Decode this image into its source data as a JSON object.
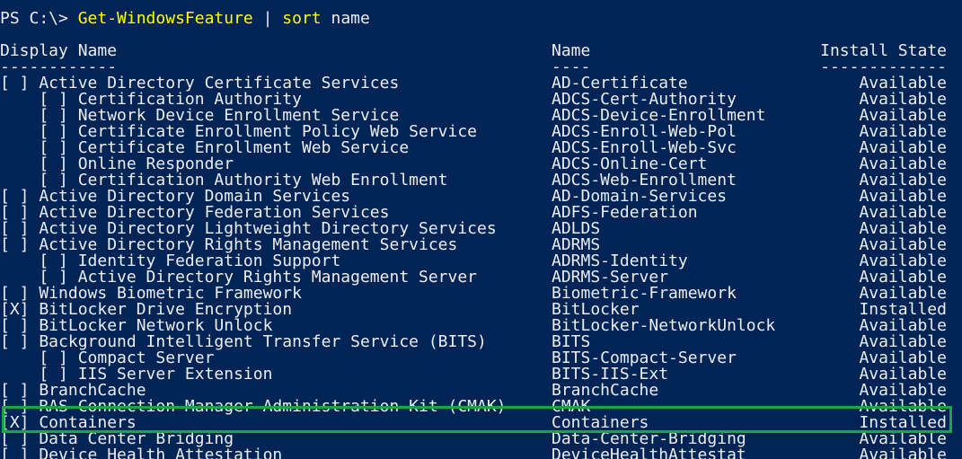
{
  "prompt": {
    "path": "PS C:\\> ",
    "cmdlet": "Get-WindowsFeature",
    "pipe": " | ",
    "sort_cmd": "sort",
    "arg": " name"
  },
  "headers": {
    "display_name": "Display Name",
    "name": "Name",
    "install_state": "Install State",
    "display_name_rule": "------------",
    "name_rule": "----",
    "install_state_rule": "-------------"
  },
  "rows": [
    {
      "display": "[ ] Active Directory Certificate Services",
      "name": "AD-Certificate",
      "state": "Available"
    },
    {
      "display": "    [ ] Certification Authority",
      "name": "ADCS-Cert-Authority",
      "state": "Available"
    },
    {
      "display": "    [ ] Network Device Enrollment Service",
      "name": "ADCS-Device-Enrollment",
      "state": "Available"
    },
    {
      "display": "    [ ] Certificate Enrollment Policy Web Service",
      "name": "ADCS-Enroll-Web-Pol",
      "state": "Available"
    },
    {
      "display": "    [ ] Certificate Enrollment Web Service",
      "name": "ADCS-Enroll-Web-Svc",
      "state": "Available"
    },
    {
      "display": "    [ ] Online Responder",
      "name": "ADCS-Online-Cert",
      "state": "Available"
    },
    {
      "display": "    [ ] Certification Authority Web Enrollment",
      "name": "ADCS-Web-Enrollment",
      "state": "Available"
    },
    {
      "display": "[ ] Active Directory Domain Services",
      "name": "AD-Domain-Services",
      "state": "Available"
    },
    {
      "display": "[ ] Active Directory Federation Services",
      "name": "ADFS-Federation",
      "state": "Available"
    },
    {
      "display": "[ ] Active Directory Lightweight Directory Services",
      "name": "ADLDS",
      "state": "Available"
    },
    {
      "display": "[ ] Active Directory Rights Management Services",
      "name": "ADRMS",
      "state": "Available"
    },
    {
      "display": "    [ ] Identity Federation Support",
      "name": "ADRMS-Identity",
      "state": "Available"
    },
    {
      "display": "    [ ] Active Directory Rights Management Server",
      "name": "ADRMS-Server",
      "state": "Available"
    },
    {
      "display": "[ ] Windows Biometric Framework",
      "name": "Biometric-Framework",
      "state": "Available"
    },
    {
      "display": "[X] BitLocker Drive Encryption",
      "name": "BitLocker",
      "state": "Installed"
    },
    {
      "display": "[ ] BitLocker Network Unlock",
      "name": "BitLocker-NetworkUnlock",
      "state": "Available"
    },
    {
      "display": "[ ] Background Intelligent Transfer Service (BITS)",
      "name": "BITS",
      "state": "Available"
    },
    {
      "display": "    [ ] Compact Server",
      "name": "BITS-Compact-Server",
      "state": "Available"
    },
    {
      "display": "    [ ] IIS Server Extension",
      "name": "BITS-IIS-Ext",
      "state": "Available"
    },
    {
      "display": "[ ] BranchCache",
      "name": "BranchCache",
      "state": "Available"
    },
    {
      "display": "[ ] RAS Connection Manager Administration Kit (CMAK)",
      "name": "CMAK",
      "state": "Available"
    },
    {
      "display": "[X] Containers",
      "name": "Containers",
      "state": "Installed"
    },
    {
      "display": "[ ] Data Center Bridging",
      "name": "Data-Center-Bridging",
      "state": "Available"
    },
    {
      "display": "[ ] Device Health Attestation",
      "name": "DeviceHealthAttestat",
      "state": "Available"
    }
  ],
  "colors": {
    "background": "#012456",
    "text": "#eeedf0",
    "cmdlet": "#ffff00",
    "highlight_border": "#1fa34a"
  }
}
